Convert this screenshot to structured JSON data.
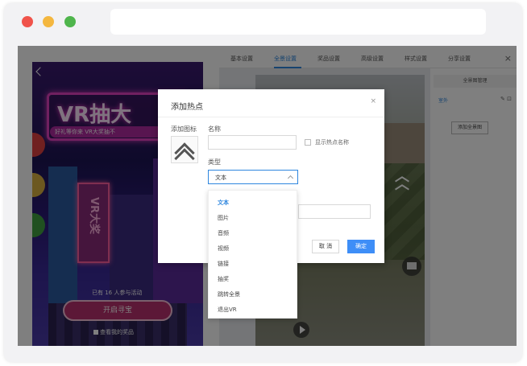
{
  "tabs": [
    {
      "label": "基本设置"
    },
    {
      "label": "全景设置"
    },
    {
      "label": "奖品设置"
    },
    {
      "label": "高级设置"
    },
    {
      "label": "样式设置"
    },
    {
      "label": "分享设置"
    }
  ],
  "tabs_close": "×",
  "phone": {
    "banner_title": "VR抽大",
    "banner_subtitle": "好礼等你来 VR大奖抽不",
    "sign_text": "VR大奖",
    "participants": "已有 16 人参与活动",
    "start_button": "开启寻宝",
    "prize_link": "查看我的奖品"
  },
  "side_panel": {
    "title": "全景图管理",
    "row_label": "室外",
    "row_icons": "✎ ⊡",
    "add_button": "添加全景图"
  },
  "modal": {
    "title": "添加热点",
    "close": "×",
    "icon_label": "添加图标",
    "name_label": "名称",
    "name_value": "",
    "show_name_label": "显示热点名称",
    "type_label": "类型",
    "type_value": "文本",
    "cancel": "取 消",
    "confirm": "确定"
  },
  "dropdown": {
    "options": [
      {
        "label": "文本"
      },
      {
        "label": "图片"
      },
      {
        "label": "音频"
      },
      {
        "label": "视频"
      },
      {
        "label": "链接"
      },
      {
        "label": "抽奖"
      },
      {
        "label": "跳转全景"
      },
      {
        "label": "退出VR"
      }
    ]
  },
  "colors": {
    "accent": "#2e86de",
    "confirm": "#3e8ef7",
    "traffic_red": "#f0534a",
    "traffic_yellow": "#f4b73f",
    "traffic_green": "#4fb54c"
  }
}
